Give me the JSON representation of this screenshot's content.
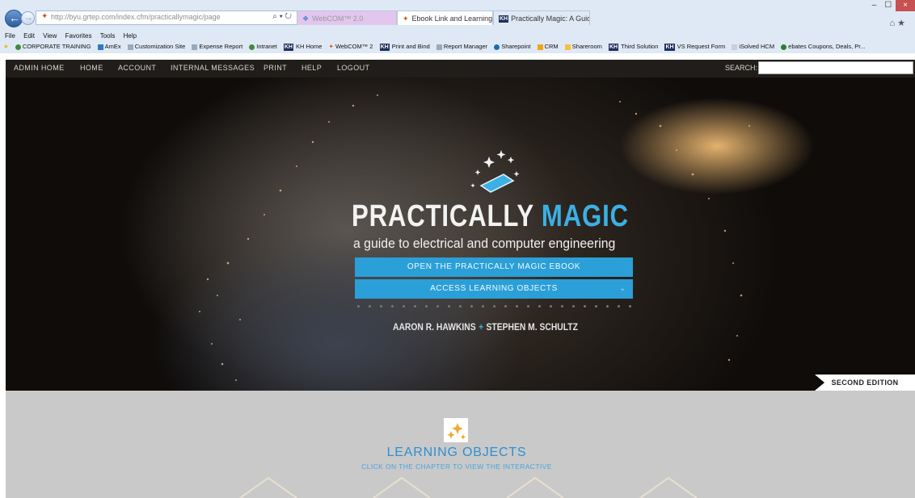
{
  "browser": {
    "address_url": "http://byu.grtep.com/index.cfm/practicallymagic/page",
    "address_tools": "⌕ ▾ ↻",
    "tabs": [
      {
        "label": "WebCOM™ 2.0",
        "icon": "webcom-icon"
      },
      {
        "label": "Ebook Link and Learning O...",
        "icon": "webcom-red-icon"
      },
      {
        "label": "Practically Magic: A Guide to E...",
        "icon": "kh-icon"
      }
    ],
    "tab_close": "×",
    "window_buttons": [
      "–",
      "☐",
      "×"
    ],
    "right_tools": "⌂ ★",
    "menu": [
      "File",
      "Edit",
      "View",
      "Favorites",
      "Tools",
      "Help"
    ],
    "favorites": [
      "CORPORATE TRAINING",
      "AmEx",
      "Customization Site",
      "Expense Report",
      "Intranet",
      "KH Home",
      "WebCOM™ 2",
      "Print and Bind",
      "Report Manager",
      "Sharepoint",
      "CRM",
      "Shareroom",
      "Third Solution",
      "VS Request Form",
      "iSolved HCM",
      "ebates Coupons, Deals, Pr..."
    ],
    "favorites_kh_label": "KH"
  },
  "site_nav": {
    "items": [
      "ADMIN HOME",
      "HOME",
      "ACCOUNT",
      "INTERNAL MESSAGES",
      "PRINT",
      "HELP",
      "LOGOUT"
    ],
    "search_label": "SEARCH:",
    "search_value": ""
  },
  "hero": {
    "title_white": "PRACTICALLY",
    "title_blue": "MAGIC",
    "subtitle": "a guide to electrical and computer engineering",
    "button_ebook": "OPEN THE PRACTICALLY MAGIC EBOOK",
    "button_learning": "ACCESS LEARNING OBJECTS",
    "chevron": "⌄",
    "author1": "AARON R. HAWKINS",
    "author_sep": "+",
    "author2": "STEPHEN M. SCHULTZ",
    "edition": "SECOND EDITION"
  },
  "learning_objects": {
    "title": "LEARNING OBJECTS",
    "subtitle": "CLICK ON THE CHAPTER TO VIEW THE INTERACTIVE"
  },
  "colors": {
    "accent_blue": "#2b9fd7",
    "title_blue": "#3cb0e4",
    "nav_bg": "#211d1a",
    "lower_bg": "#c9c9c9"
  }
}
